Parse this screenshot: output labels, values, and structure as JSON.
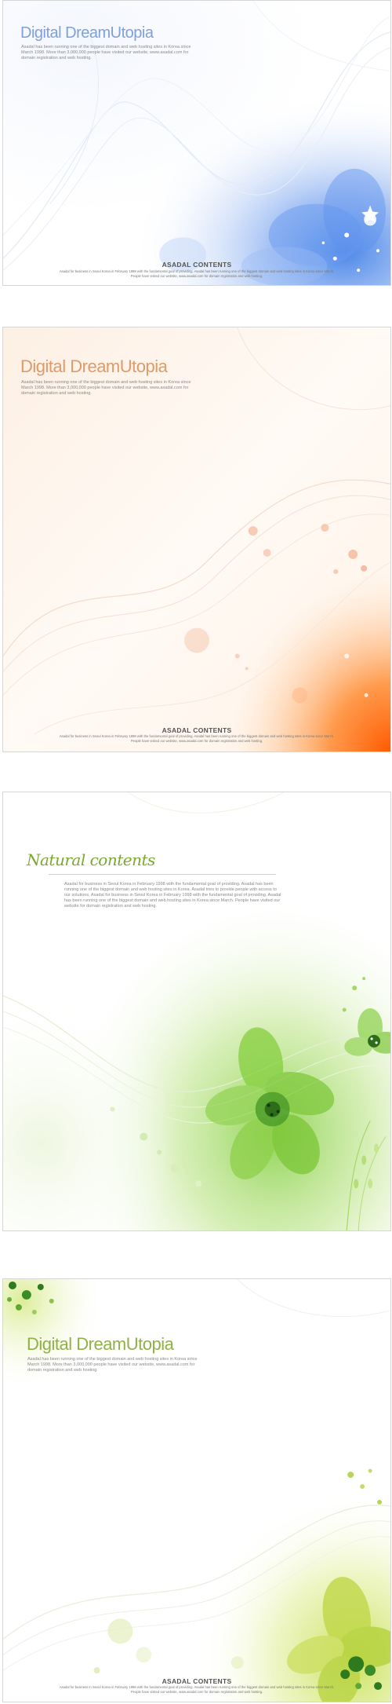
{
  "cards": [
    {
      "theme": "blue",
      "accent": "#5b8ee8",
      "title": "Digital DreamUtopia",
      "body": "Asadal has been running one of the biggest domain and web hosting sites in Korea since March 1998. More than 3,000,000 people have visited our website, www.asadal.com for domain registration and web hosting.",
      "footer_title": "ASADAL CONTENTS",
      "footer_text": "Asadal for business in Seoul Korea in February 1998 with the fundamental goal of providing. Asadal has been running one of the biggest domain and web hosting sites in Korea since March. People have visited our website, www.asadal.com for domain registration and web hosting."
    },
    {
      "theme": "orange",
      "accent": "#ff6a10",
      "title": "Digital DreamUtopia",
      "body": "Asadal has been running one of the biggest domain and web hosting sites in Korea since March 1998. More than 3,000,000 people have visited our website, www.asadal.com for domain registration and web hosting.",
      "footer_title": "ASADAL CONTENTS",
      "footer_text": "Asadal for business in Seoul Korea in February 1998 with the fundamental goal of providing. Asadal has been running one of the biggest domain and web hosting sites in Korea since March. People have visited our website, www.asadal.com for domain registration and web hosting."
    },
    {
      "theme": "green",
      "accent": "#6cc040",
      "title": "Natural contents",
      "body": "Asadal for business in Seoul Korea in February 1998 with the fundamental goal of providing. Asadal has been running one of the biggest domain and web hosting sites in Korea. Asadal tries to provide people with access to our solutions. Asadal for business in Seoul Korea in February 1998 with the fundamental goal of providing. Asadal has been running one of the biggest domain and web hosting sites in Korea since March. People have visited our website for domain registration and web hosting."
    },
    {
      "theme": "lime",
      "accent": "#a8cc30",
      "title": "Digital DreamUtopia",
      "body": "Asadal has been running one of the biggest domain and web hosting sites in Korea since March 1998. More than 3,000,000 people have visited our website, www.asadal.com for domain registration and web hosting.",
      "footer_title": "ASADAL CONTENTS",
      "footer_text": "Asadal for business in Seoul Korea in February 1998 with the fundamental goal of providing. Asadal has been running one of the biggest domain and web hosting sites in Korea since March. People have visited our website, www.asadal.com for domain registration and web hosting."
    }
  ]
}
